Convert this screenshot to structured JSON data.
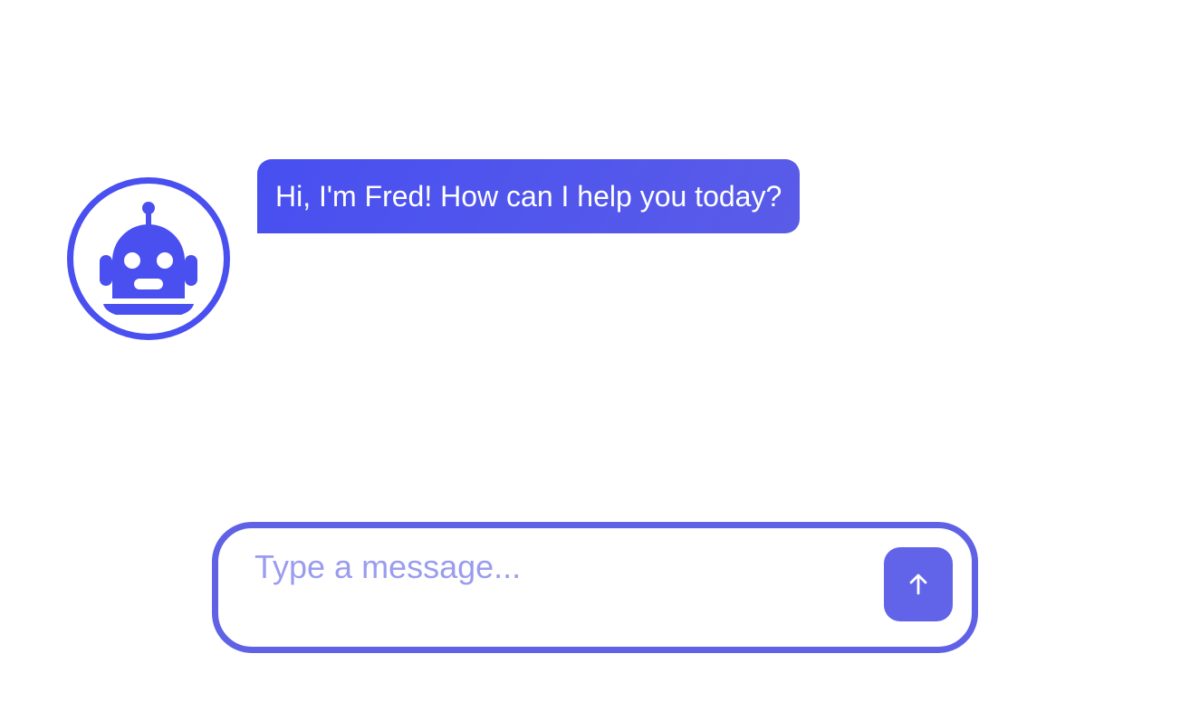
{
  "chat": {
    "assistant_avatar_icon": "robot-icon",
    "messages": [
      {
        "sender": "assistant",
        "text": "Hi, I'm Fred! How can I help you today?"
      }
    ]
  },
  "composer": {
    "placeholder": "Type a message...",
    "value": "",
    "send_icon": "arrow-up-icon"
  },
  "colors": {
    "accent": "#4a4ff0",
    "composer_border": "#6062e6",
    "send_button": "#6163e9",
    "placeholder": "#9a9cef",
    "bubble_text": "#ffffff"
  }
}
